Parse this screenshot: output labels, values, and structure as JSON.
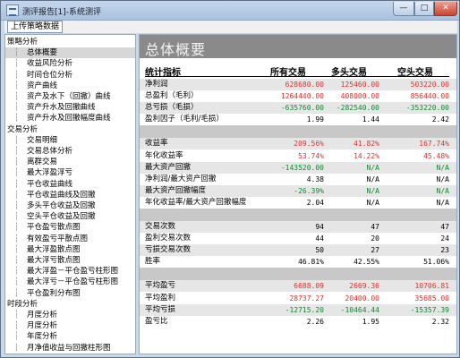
{
  "window": {
    "title": "测评报告[1]-系统测评"
  },
  "controls": {
    "minimize": "—",
    "maximize": "□",
    "close": "✕"
  },
  "toolbar": {
    "upload_label": "上传策略数据"
  },
  "tree": {
    "items": [
      {
        "label": "策略分析",
        "level": 0
      },
      {
        "label": "总体概要",
        "level": 1,
        "selected": true
      },
      {
        "label": "收益风险分析",
        "level": 1
      },
      {
        "label": "时间仓位分析",
        "level": 1
      },
      {
        "label": "资产曲线",
        "level": 1
      },
      {
        "label": "资产及水下（回撤）曲线",
        "level": 1
      },
      {
        "label": "资产升水及回撤曲线",
        "level": 1
      },
      {
        "label": "资产升水及回撤幅度曲线",
        "level": 1
      },
      {
        "label": "交易分析",
        "level": 0
      },
      {
        "label": "交易明细",
        "level": 1
      },
      {
        "label": "交易总体分析",
        "level": 1
      },
      {
        "label": "离群交易",
        "level": 1
      },
      {
        "label": "最大浮盈浮亏",
        "level": 1
      },
      {
        "label": "平仓收益曲线",
        "level": 1
      },
      {
        "label": "平仓收益曲线及回撤",
        "level": 1
      },
      {
        "label": "多头平仓收益及回撤",
        "level": 1
      },
      {
        "label": "空头平仓收益及回撤",
        "level": 1
      },
      {
        "label": "平仓盈亏散点图",
        "level": 1
      },
      {
        "label": "有效盈亏平散点图",
        "level": 1
      },
      {
        "label": "最大浮盈散点图",
        "level": 1
      },
      {
        "label": "最大浮亏散点图",
        "level": 1
      },
      {
        "label": "最大浮盈－平仓盈亏柱形图",
        "level": 1
      },
      {
        "label": "最大浮亏－平仓盈亏柱形图",
        "level": 1
      },
      {
        "label": "平仓盈利分布图",
        "level": 1
      },
      {
        "label": "时段分析",
        "level": 0
      },
      {
        "label": "月度分析",
        "level": 1
      },
      {
        "label": "月度分析",
        "level": 1
      },
      {
        "label": "年度分析",
        "level": 1
      },
      {
        "label": "月净值收益与回撤柱形图",
        "level": 1
      }
    ]
  },
  "report": {
    "title": "总体概要",
    "headers": [
      "统计指标",
      "所有交易",
      "多头交易",
      "空头交易"
    ],
    "rows": [
      {
        "label": "净利润",
        "all": "628680.00",
        "long": "125460.00",
        "short": "503220.00",
        "color": "red",
        "shade": true
      },
      {
        "label": "总盈利（毛利）",
        "all": "1264440.00",
        "long": "408000.00",
        "short": "856440.00",
        "color": "red",
        "shade": false
      },
      {
        "label": "总亏损（毛损）",
        "all": "-635760.00",
        "long": "-282540.00",
        "short": "-353220.00",
        "color": "green",
        "shade": true
      },
      {
        "label": "盈利因子（毛利/毛损）",
        "all": "1.99",
        "long": "1.44",
        "short": "2.42",
        "color": "black",
        "shade": false
      },
      {
        "label": "",
        "all": "",
        "long": "",
        "short": "",
        "color": "black",
        "shade": false,
        "gap": true
      },
      {
        "label": "收益率",
        "all": "209.56%",
        "long": "41.82%",
        "short": "167.74%",
        "color": "red",
        "shade": true
      },
      {
        "label": "年化收益率",
        "all": "53.74%",
        "long": "14.22%",
        "short": "45.48%",
        "color": "red",
        "shade": false
      },
      {
        "label": "最大资产回撤",
        "all": "-143520.00",
        "long": "N/A",
        "short": "N/A",
        "color": "green",
        "shade": true
      },
      {
        "label": "净利润/最大资产回撤",
        "all": "4.38",
        "long": "N/A",
        "short": "N/A",
        "color": "black",
        "shade": false
      },
      {
        "label": "最大资产回撤幅度",
        "all": "-26.39%",
        "long": "N/A",
        "short": "N/A",
        "color": "green",
        "shade": true
      },
      {
        "label": "年化收益率/最大资产回撤幅度",
        "all": "2.04",
        "long": "N/A",
        "short": "N/A",
        "color": "black",
        "shade": false
      },
      {
        "label": "",
        "all": "",
        "long": "",
        "short": "",
        "color": "black",
        "shade": false,
        "gap": true
      },
      {
        "label": "交易次数",
        "all": "94",
        "long": "47",
        "short": "47",
        "color": "black",
        "shade": true
      },
      {
        "label": "盈利交易次数",
        "all": "44",
        "long": "20",
        "short": "24",
        "color": "black",
        "shade": false
      },
      {
        "label": "亏损交易次数",
        "all": "50",
        "long": "27",
        "short": "23",
        "color": "black",
        "shade": true
      },
      {
        "label": "胜率",
        "all": "46.81%",
        "long": "42.55%",
        "short": "51.06%",
        "color": "black",
        "shade": false
      },
      {
        "label": "",
        "all": "",
        "long": "",
        "short": "",
        "color": "black",
        "shade": false,
        "gap": true
      },
      {
        "label": "平均盈亏",
        "all": "6688.09",
        "long": "2669.36",
        "short": "10706.81",
        "color": "red",
        "shade": true
      },
      {
        "label": "平均盈利",
        "all": "28737.27",
        "long": "20400.00",
        "short": "35685.00",
        "color": "red",
        "shade": false
      },
      {
        "label": "平均亏损",
        "all": "-12715.20",
        "long": "-10464.44",
        "short": "-15357.39",
        "color": "green",
        "shade": true
      },
      {
        "label": "盈亏比",
        "all": "2.26",
        "long": "1.95",
        "short": "2.32",
        "color": "black",
        "shade": false
      }
    ]
  }
}
